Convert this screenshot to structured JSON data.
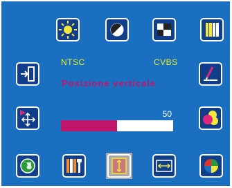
{
  "colors": {
    "background": "#1a6fc0",
    "accent": "#c0166b",
    "label": "#e8ef2c",
    "icon_border": "#ffffff",
    "icon_fill": "#113e8a"
  },
  "top_icons": [
    {
      "name": "brightness-icon"
    },
    {
      "name": "contrast-icon"
    },
    {
      "name": "picture-position-icon"
    },
    {
      "name": "color-bars-icon"
    }
  ],
  "left_icons": [
    {
      "name": "input-select-icon"
    },
    {
      "name": "position-move-icon"
    }
  ],
  "right_icons": [
    {
      "name": "edit-icon"
    },
    {
      "name": "color-settings-icon"
    }
  ],
  "bottom_icons": [
    {
      "name": "language-icon"
    },
    {
      "name": "tools-icon"
    },
    {
      "name": "vertical-position-icon",
      "selected": true
    },
    {
      "name": "horizontal-position-icon"
    },
    {
      "name": "color-temperature-icon"
    }
  ],
  "signal": {
    "standard": "NTSC",
    "source": "CVBS"
  },
  "setting": {
    "title": "Posizione verticale",
    "value": "50",
    "level": 0.5
  }
}
